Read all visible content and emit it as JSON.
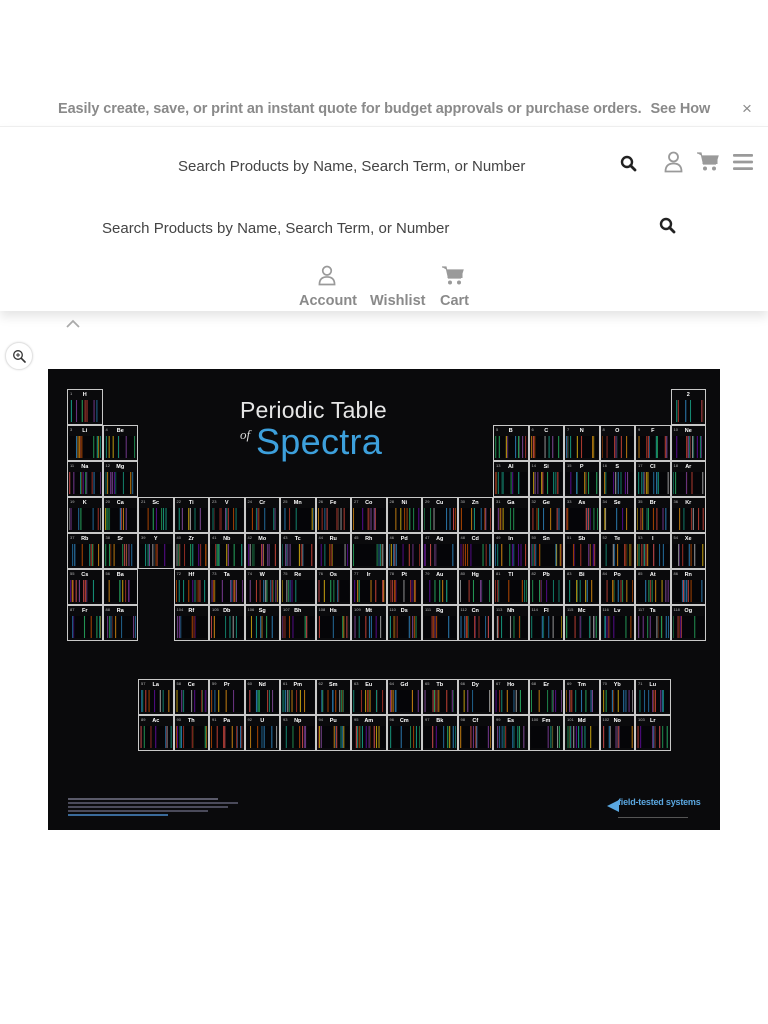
{
  "banner": {
    "message": "Easily create, save, or print an instant quote for budget approvals or purchase orders.",
    "link_label": "See How",
    "close_label": "×"
  },
  "header": {
    "search_top": {
      "placeholder": "Search Products by Name, Search Term, or Number"
    },
    "search_main": {
      "placeholder": "Search Products by Name, Search Term, or Number"
    },
    "icons": [
      "search-icon",
      "user-icon",
      "cart-icon",
      "menu-icon"
    ],
    "nav": [
      {
        "label": "Account",
        "icon": "user-icon"
      },
      {
        "label": "Wishlist",
        "icon": ""
      },
      {
        "label": "Cart",
        "icon": "cart-icon"
      }
    ]
  },
  "gallery": {
    "zoom_icon": "zoom-in-icon",
    "collapse_icon": "chevron-up-icon"
  },
  "product_image": {
    "title_line1": "Periodic Table",
    "title_of": "of",
    "title_line2": "Spectra",
    "brand": "field-tested systems",
    "main_table": [
      [
        "1",
        "H",
        "",
        "",
        "",
        "",
        "",
        "",
        "",
        "",
        "",
        "",
        "",
        "",
        "",
        "",
        "",
        "2",
        "He"
      ],
      [
        "3",
        "Li",
        "4",
        "Be",
        "5",
        "B",
        "6",
        "C",
        "7",
        "N",
        "8",
        "O",
        "9",
        "F",
        "10",
        "Ne"
      ],
      [
        "11",
        "Na",
        "12",
        "Mg",
        "13",
        "Al",
        "14",
        "Si",
        "15",
        "P",
        "16",
        "S",
        "17",
        "Cl",
        "18",
        "Ar"
      ],
      [
        "19",
        "K",
        "20",
        "Ca",
        "21",
        "Sc",
        "22",
        "Ti",
        "23",
        "V",
        "24",
        "Cr",
        "25",
        "Mn",
        "26",
        "Fe",
        "27",
        "Co",
        "28",
        "Ni",
        "29",
        "Cu",
        "30",
        "Zn",
        "31",
        "Ga",
        "32",
        "Ge",
        "33",
        "As",
        "34",
        "Se",
        "35",
        "Br",
        "36",
        "Kr"
      ],
      [
        "37",
        "Rb",
        "38",
        "Sr",
        "39",
        "Y",
        "40",
        "Zr",
        "41",
        "Nb",
        "42",
        "Mo",
        "43",
        "Tc",
        "44",
        "Ru",
        "45",
        "Rh",
        "46",
        "Pd",
        "47",
        "Ag",
        "48",
        "Cd",
        "49",
        "In",
        "50",
        "Sn",
        "51",
        "Sb",
        "52",
        "Te",
        "53",
        "I",
        "54",
        "Xe"
      ],
      [
        "55",
        "Cs",
        "56",
        "Ba",
        "",
        "",
        "72",
        "Hf",
        "73",
        "Ta",
        "74",
        "W",
        "75",
        "Re",
        "76",
        "Os",
        "77",
        "Ir",
        "78",
        "Pt",
        "79",
        "Au",
        "80",
        "Hg",
        "81",
        "Tl",
        "82",
        "Pb",
        "83",
        "Bi",
        "84",
        "Po",
        "85",
        "At",
        "86",
        "Rn"
      ],
      [
        "87",
        "Fr",
        "88",
        "Ra",
        "",
        "",
        "104",
        "Rf",
        "105",
        "Db",
        "106",
        "Sg",
        "107",
        "Bh",
        "108",
        "Hs",
        "109",
        "Mt",
        "110",
        "Ds",
        "111",
        "Rg",
        "112",
        "Cn",
        "113",
        "Nh",
        "114",
        "Fl",
        "115",
        "Mc",
        "116",
        "Lv",
        "117",
        "Ts",
        "118",
        "Og"
      ]
    ],
    "lanthanides": [
      "57 La",
      "58 Ce",
      "59 Pr",
      "60 Nd",
      "61 Pm",
      "62 Sm",
      "63 Eu",
      "64 Gd",
      "65 Tb",
      "66 Dy",
      "67 Ho",
      "68 Er",
      "69 Tm",
      "70 Yb",
      "71 Lu"
    ],
    "actinides": [
      "89 Ac",
      "90 Th",
      "91 Pa",
      "92 U",
      "93 Np",
      "94 Pu",
      "95 Am",
      "96 Cm",
      "97 Bk",
      "98 Cf",
      "99 Es",
      "100 Fm",
      "101 Md",
      "102 No",
      "103 Lr"
    ]
  },
  "colors": {
    "banner_text": "#8a8a8a",
    "icon_gray": "#9a9a9a",
    "product_bg": "#0a0a0c",
    "title_accent": "#3da0dc",
    "brand_accent": "#5aa7e0"
  }
}
